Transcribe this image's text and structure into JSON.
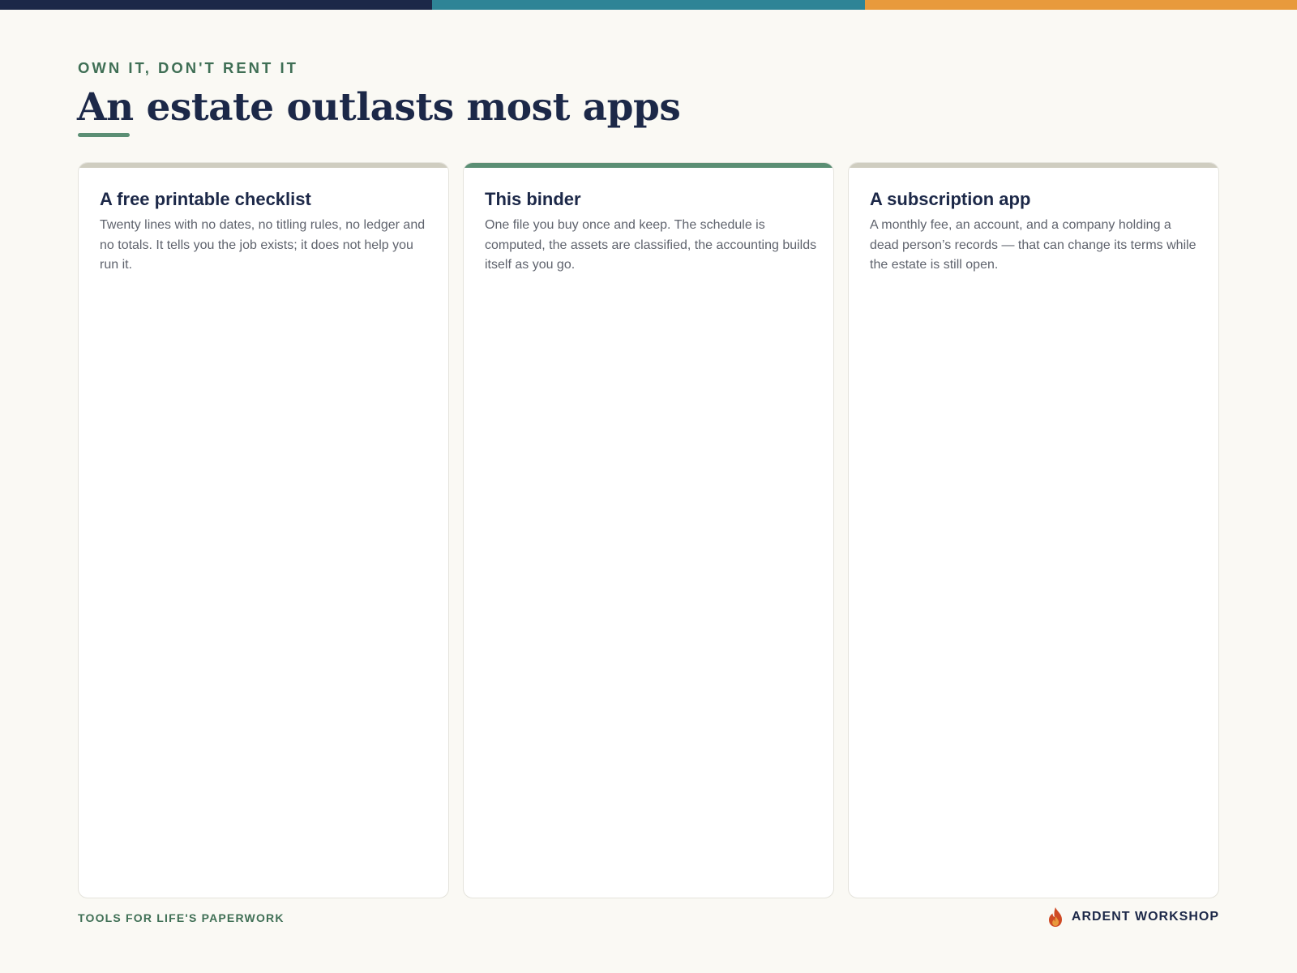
{
  "colors": {
    "background": "#faf9f4",
    "navy": "#1c2848",
    "teal": "#2e8496",
    "orange": "#e89a3c",
    "green": "#3f6f55",
    "sage": "#5b8f74",
    "muted_rule": "#cfcdc0",
    "body_text": "#5f636d",
    "brand_flame": "#cf4a24"
  },
  "header": {
    "eyebrow": "OWN IT, DON'T RENT IT",
    "title": "An estate outlasts most apps"
  },
  "cards": [
    {
      "title": "A free printable checklist",
      "body": "Twenty lines with no dates, no titling rules, no ledger and no totals. It tells you the job exists; it does not help you run it.",
      "highlighted": false
    },
    {
      "title": "This binder",
      "body": "One file you buy once and keep. The schedule is computed, the assets are classified, the accounting builds itself as you go.",
      "highlighted": true
    },
    {
      "title": "A subscription app",
      "body": "A monthly fee, an account, and a company holding a dead person’s records — that can change its terms while the estate is still open.",
      "highlighted": false
    }
  ],
  "footer": {
    "tagline": "TOOLS FOR LIFE'S PAPERWORK",
    "brand_name": "ARDENT WORKSHOP",
    "brand_icon": "flame-icon"
  }
}
